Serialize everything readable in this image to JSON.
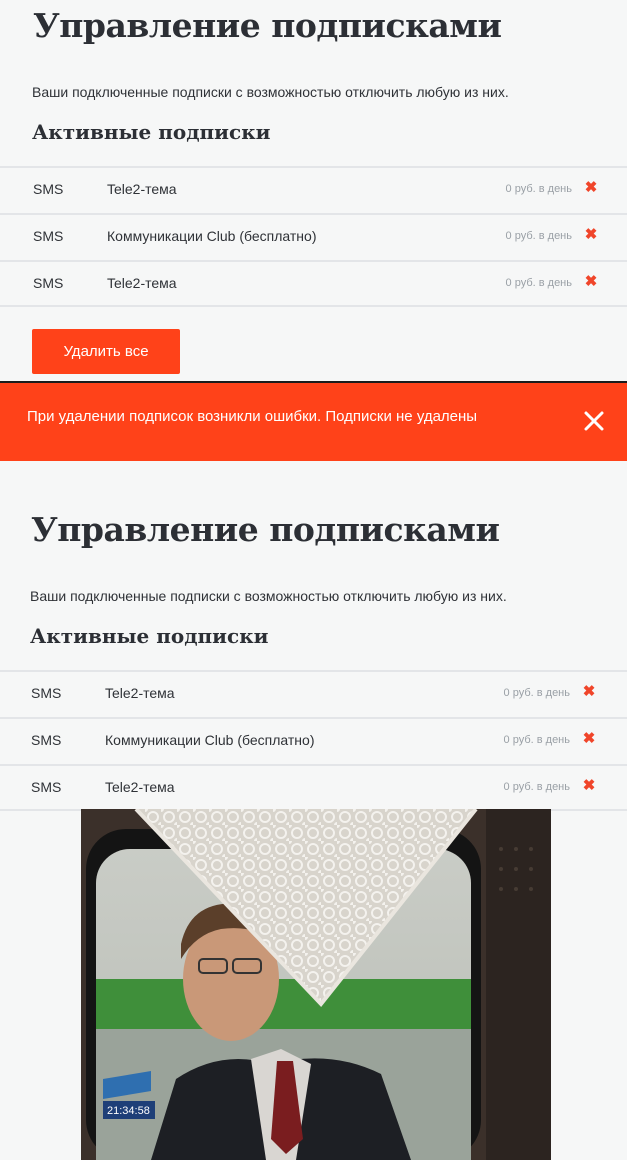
{
  "top": {
    "title": "Управление подписками",
    "description": "Ваши подключенные подписки с возможностью отключить любую из них.",
    "subtitle": "Активные подписки",
    "subscriptions": [
      {
        "type": "SMS",
        "name": "Tele2-тема",
        "price": "0 руб. в день",
        "delete_icon": "✖"
      },
      {
        "type": "SMS",
        "name": "Коммуникации Club (бесплатно)",
        "price": "0 руб. в день",
        "delete_icon": "✖"
      },
      {
        "type": "SMS",
        "name": "Tele2-тема",
        "price": "0 руб. в день",
        "delete_icon": "✖"
      }
    ],
    "delete_all_label": "Удалить все"
  },
  "error": {
    "message": "При удалении подписок возникли ошибки. Подписки не удалены",
    "close_icon": "close-icon"
  },
  "bottom": {
    "title": "Управление подписками",
    "description": "Ваши подключенные подписки с возможностью отключить любую из них.",
    "subtitle": "Активные подписки",
    "subscriptions": [
      {
        "type": "SMS",
        "name": "Tele2-тема",
        "price": "0 руб. в день",
        "delete_icon": "✖"
      },
      {
        "type": "SMS",
        "name": "Коммуникации Club (бесплатно)",
        "price": "0 руб. в день",
        "delete_icon": "✖"
      },
      {
        "type": "SMS",
        "name": "Tele2-тема",
        "price": "0 руб. в день",
        "delete_icon": "✖"
      }
    ]
  },
  "photo": {
    "timestamp": "21:34:58"
  },
  "colors": {
    "accent": "#ff4219",
    "delete_icon": "#f0452a",
    "background": "#f6f7f7",
    "divider": "#e3e5e8"
  }
}
